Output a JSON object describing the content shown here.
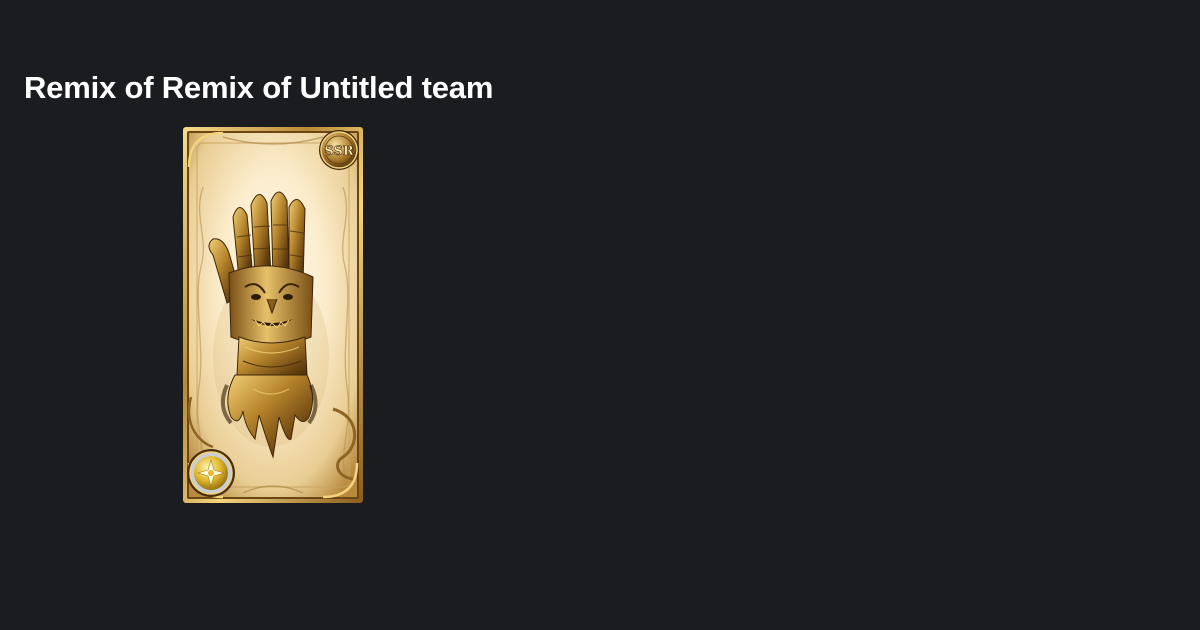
{
  "page": {
    "title": "Remix of Remix of Untitled team"
  },
  "card": {
    "rarity_badge": "SSR",
    "subject_icon": "golden-gauntlet-icon",
    "element_icon": "light-element-icon",
    "colors": {
      "background": "#1b1c1f",
      "frame_gold": "#c9a04a",
      "card_glow": "#fff4d6",
      "gauntlet_gold": "#b7852c"
    }
  }
}
